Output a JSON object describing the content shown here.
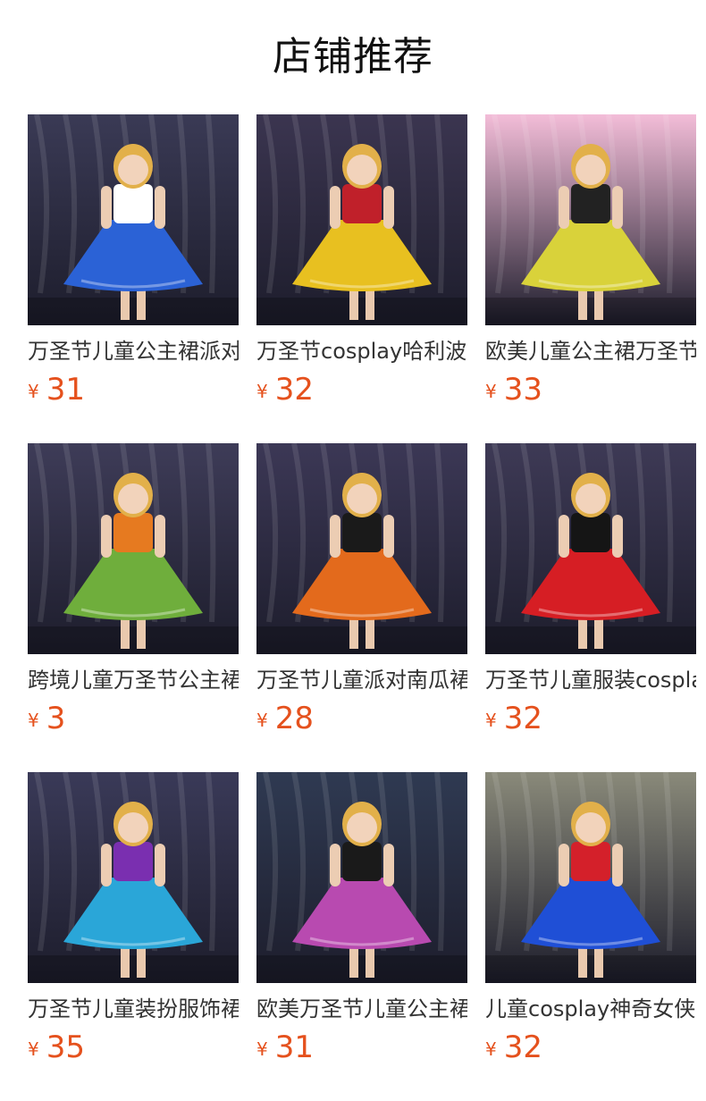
{
  "page": {
    "title": "店铺推荐",
    "currency_symbol": "¥"
  },
  "products": [
    {
      "name": "万圣节儿童公主裙派对",
      "price": "31",
      "image": "bunny-ears-blue-tutu-dress",
      "bg": "#3a3a55",
      "dress": "#2b62d6",
      "accent": "#ffffff"
    },
    {
      "name": "万圣节cosplay哈利波特",
      "price": "32",
      "image": "witch-hat-red-yellow-black-tutu",
      "bg": "#3b3550",
      "dress": "#e8c020",
      "accent": "#c0202a"
    },
    {
      "name": "欧美儿童公主裙万圣节",
      "price": "33",
      "image": "bee-costume-yellow-black-tutu",
      "bg": "#f3bdd8",
      "dress": "#d9d23a",
      "accent": "#222222"
    },
    {
      "name": "跨境儿童万圣节公主裙",
      "price": "3",
      "image": "witch-rainbow-tutu-dress",
      "bg": "#3e3c58",
      "dress": "#6fae3c",
      "accent": "#e67a20"
    },
    {
      "name": "万圣节儿童派对南瓜裙",
      "price": "28",
      "image": "pumpkin-orange-black-tutu-dress",
      "bg": "#3c3856",
      "dress": "#e36a1c",
      "accent": "#1a1a1a"
    },
    {
      "name": "万圣节儿童服装cosplay",
      "price": "32",
      "image": "harley-red-black-tutu-dress",
      "bg": "#3e3a56",
      "dress": "#d61e24",
      "accent": "#151515"
    },
    {
      "name": "万圣节儿童装扮服饰裙",
      "price": "35",
      "image": "rag-doll-blue-purple-tutu-dress",
      "bg": "#3a3a58",
      "dress": "#2aa6d8",
      "accent": "#7a2fb0"
    },
    {
      "name": "欧美万圣节儿童公主裙",
      "price": "31",
      "image": "pirate-pink-tutu-dress-ship",
      "bg": "#2f3a52",
      "dress": "#b84ab0",
      "accent": "#1a1a1a"
    },
    {
      "name": "儿童cosplay神奇女侠裙",
      "price": "32",
      "image": "wonder-girl-blue-tutu-dress",
      "bg": "#8a8a7a",
      "dress": "#1f4fd6",
      "accent": "#d4202a"
    }
  ]
}
